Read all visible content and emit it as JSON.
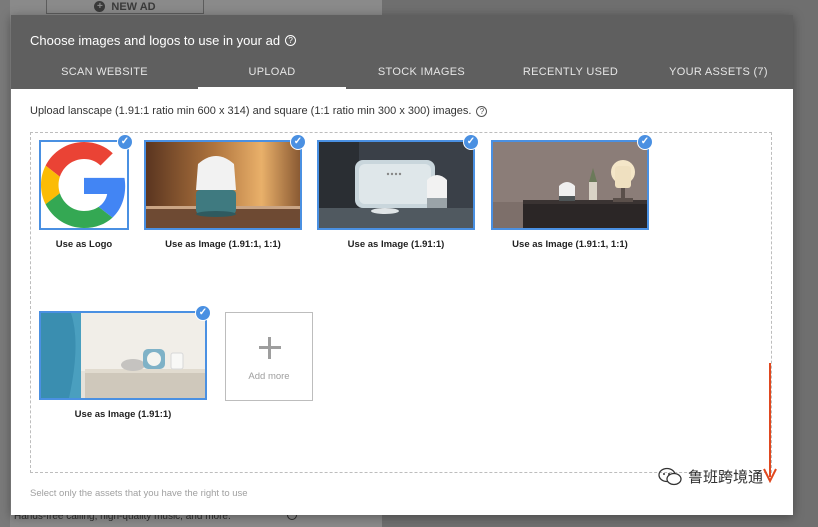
{
  "background": {
    "new_ad_label": "NEW AD",
    "bottom_text": "Hands-free calling, high-quality music, and more."
  },
  "dialog": {
    "title": "Choose images and logos to use in your ad",
    "tabs": [
      {
        "label": "SCAN WEBSITE"
      },
      {
        "label": "UPLOAD"
      },
      {
        "label": "STOCK IMAGES"
      },
      {
        "label": "RECENTLY USED"
      },
      {
        "label": "YOUR ASSETS (7)"
      }
    ],
    "active_tab": "UPLOAD",
    "instructions": "Upload lanscape (1.91:1 ratio min 600 x 314) and square (1:1 ratio min 300 x 300) images.",
    "assets": [
      {
        "caption": "Use as Logo",
        "selected": true,
        "icon": "google-g-logo"
      },
      {
        "caption": "Use as Image (1.91:1, 1:1)",
        "selected": true,
        "icon": "smart-speaker-photo"
      },
      {
        "caption": "Use as Image (1.91:1)",
        "selected": true,
        "icon": "smart-display-photo"
      },
      {
        "caption": "Use as Image (1.91:1, 1:1)",
        "selected": true,
        "icon": "speaker-lamp-photo"
      },
      {
        "caption": "Use as Image (1.91:1)",
        "selected": true,
        "icon": "bedside-speaker-photo"
      }
    ],
    "add_more_label": "Add more",
    "footer_note": "Select only the assets that you have the right to use",
    "check_glyph": "✓"
  },
  "watermark": {
    "text": "鲁班跨境通"
  },
  "colors": {
    "accent": "#4a90e2",
    "header": "#5f5f5f",
    "arrow": "#e0481f"
  }
}
